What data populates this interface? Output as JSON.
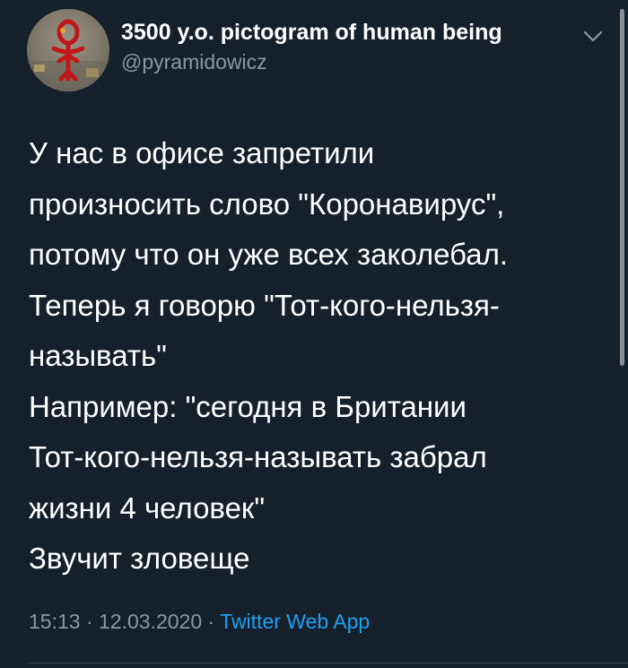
{
  "user": {
    "display_name": "3500 y.o. pictogram of human being",
    "handle": "@pyramidowicz",
    "avatar_icon": "pictogram-avatar-icon"
  },
  "menu": {
    "icon": "chevron-down-icon"
  },
  "tweet": {
    "lines": [
      "У нас в офисе запретили",
      "произносить слово \"Коронавирус\",",
      "потому что он уже всех заколебал.",
      "Теперь я говорю \"Тот-кого-нельзя-",
      "называть\"",
      "Например: \"сегодня в Британии",
      "Тот-кого-нельзя-называть забрал",
      "жизни 4 человек\"",
      "Звучит зловеще"
    ]
  },
  "meta": {
    "time": "15:13",
    "separator1": " · ",
    "date": "12.03.2020",
    "separator2": " · ",
    "source": "Twitter Web App"
  },
  "colors": {
    "background": "#15202b",
    "text": "#ffffff",
    "secondary": "#8899a6",
    "link": "#1da1f2"
  }
}
